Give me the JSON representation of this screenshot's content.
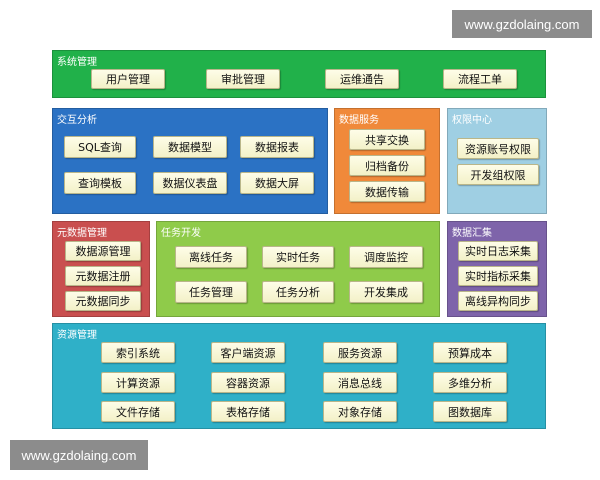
{
  "watermark": "www.gzdolaing.com",
  "panels": {
    "system": {
      "title": "系统管理",
      "items": [
        "用户管理",
        "审批管理",
        "运维通告",
        "流程工单"
      ]
    },
    "interactive": {
      "title": "交互分析",
      "items": [
        "SQL查询",
        "数据模型",
        "数据报表",
        "查询模板",
        "数据仪表盘",
        "数据大屏"
      ]
    },
    "data_service": {
      "title": "数据服务",
      "items": [
        "共享交换",
        "归档备份",
        "数据传输"
      ]
    },
    "permission": {
      "title": "权限中心",
      "items": [
        "资源账号权限",
        "开发组权限"
      ]
    },
    "metadata": {
      "title": "元数据管理",
      "items": [
        "数据源管理",
        "元数据注册",
        "元数据同步"
      ]
    },
    "task_dev": {
      "title": "任务开发",
      "items": [
        "离线任务",
        "实时任务",
        "调度监控",
        "任务管理",
        "任务分析",
        "开发集成"
      ]
    },
    "data_collect": {
      "title": "数据汇集",
      "items": [
        "实时日志采集",
        "实时指标采集",
        "离线异构同步"
      ]
    },
    "resource": {
      "title": "资源管理",
      "items": [
        "索引系统",
        "客户端资源",
        "服务资源",
        "预算成本",
        "计算资源",
        "容器资源",
        "消息总线",
        "多维分析",
        "文件存储",
        "表格存储",
        "对象存储",
        "图数据库"
      ]
    }
  }
}
